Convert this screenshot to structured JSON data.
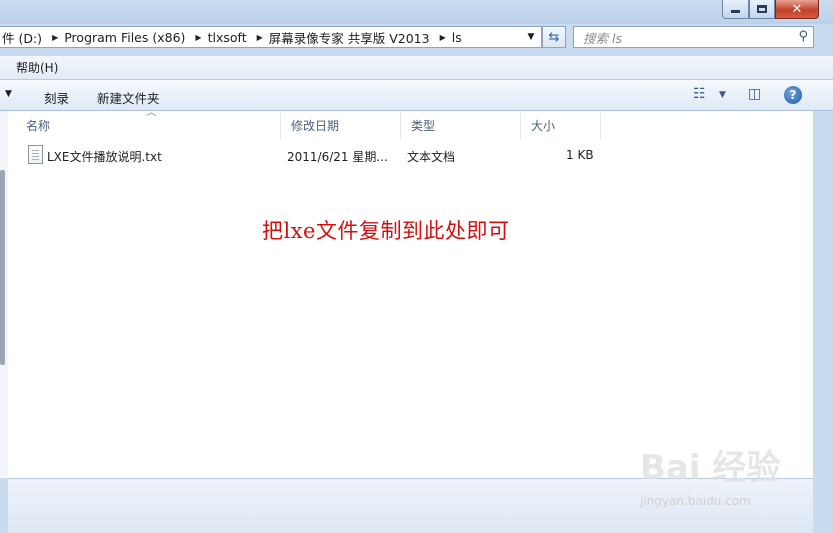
{
  "window": {
    "minimize_icon": "minimize-icon",
    "maximize_icon": "maximize-icon",
    "close_icon": "close-icon",
    "close_glyph": "✕"
  },
  "address": {
    "crumbs": [
      "件 (D:)",
      "Program Files (x86)",
      "tlxsoft",
      "屏幕录像专家 共享版 V2013",
      "ls"
    ],
    "search_placeholder": "搜索 ls"
  },
  "menu": {
    "help": "帮助(H)"
  },
  "toolbar": {
    "burn": "刻录",
    "new_folder": "新建文件夹"
  },
  "columns": {
    "name": "名称",
    "modified": "修改日期",
    "type": "类型",
    "size": "大小"
  },
  "files": [
    {
      "name": "LXE文件播放说明.txt",
      "modified": "2011/6/21 星期...",
      "type": "文本文档",
      "size": "1 KB"
    }
  ],
  "annotation": "把lxe文件复制到此处即可",
  "watermark": {
    "brand": "Bai 经验",
    "url": "jingyan.baidu.com"
  }
}
